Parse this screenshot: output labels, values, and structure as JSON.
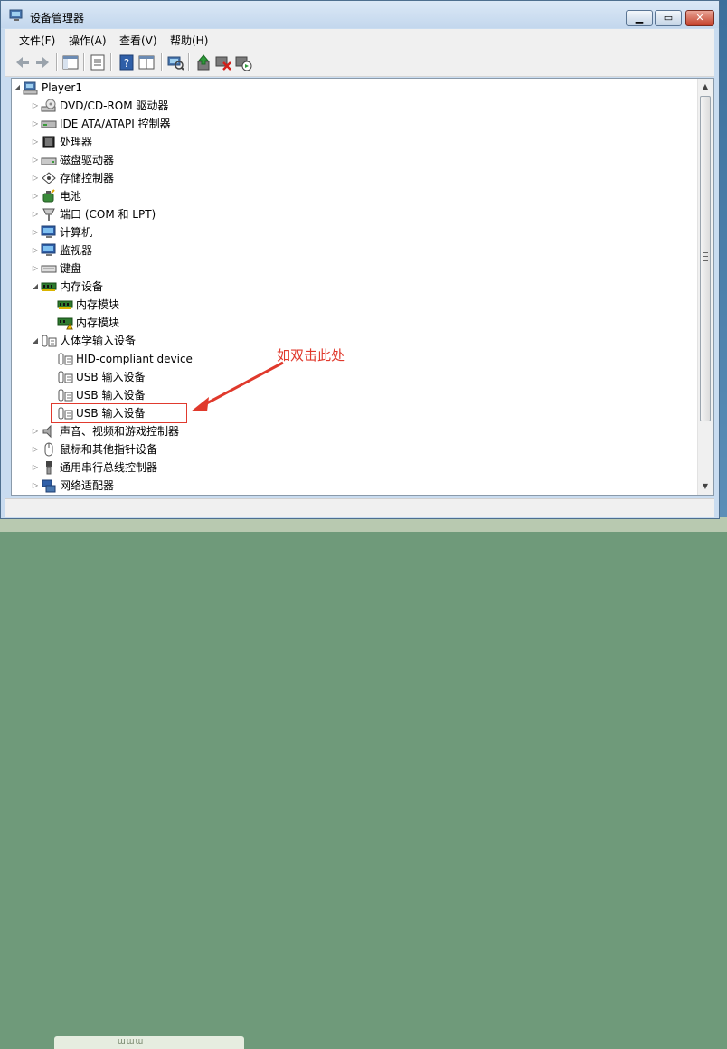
{
  "window": {
    "title": "设备管理器"
  },
  "menu": [
    "文件(F)",
    "操作(A)",
    "查看(V)",
    "帮助(H)"
  ],
  "toolbar": [
    "back-icon",
    "forward-icon",
    "console-tree-icon",
    "properties-icon",
    "help-icon",
    "details-icon",
    "scan-hardware-icon",
    "update-driver-icon",
    "uninstall-icon",
    "enable-device-icon"
  ],
  "tree": [
    {
      "label": "Player1",
      "depth": 0,
      "expander": "open",
      "icon": "computer"
    },
    {
      "label": "DVD/CD-ROM 驱动器",
      "depth": 1,
      "expander": "closed",
      "icon": "dvd"
    },
    {
      "label": "IDE ATA/ATAPI 控制器",
      "depth": 1,
      "expander": "closed",
      "icon": "ide"
    },
    {
      "label": "处理器",
      "depth": 1,
      "expander": "closed",
      "icon": "cpu"
    },
    {
      "label": "磁盘驱动器",
      "depth": 1,
      "expander": "closed",
      "icon": "disk"
    },
    {
      "label": "存储控制器",
      "depth": 1,
      "expander": "closed",
      "icon": "storage"
    },
    {
      "label": "电池",
      "depth": 1,
      "expander": "closed",
      "icon": "battery"
    },
    {
      "label": "端口 (COM 和 LPT)",
      "depth": 1,
      "expander": "closed",
      "icon": "port"
    },
    {
      "label": "计算机",
      "depth": 1,
      "expander": "closed",
      "icon": "monitor"
    },
    {
      "label": "监视器",
      "depth": 1,
      "expander": "closed",
      "icon": "monitor"
    },
    {
      "label": "键盘",
      "depth": 1,
      "expander": "closed",
      "icon": "keyboard"
    },
    {
      "label": "内存设备",
      "depth": 1,
      "expander": "open",
      "icon": "memory"
    },
    {
      "label": "内存模块",
      "depth": 2,
      "expander": "none",
      "icon": "memory"
    },
    {
      "label": "内存模块",
      "depth": 2,
      "expander": "none",
      "icon": "memory-warn"
    },
    {
      "label": "人体学输入设备",
      "depth": 1,
      "expander": "open",
      "icon": "hid"
    },
    {
      "label": "HID-compliant device",
      "depth": 2,
      "expander": "none",
      "icon": "hid"
    },
    {
      "label": "USB 输入设备",
      "depth": 2,
      "expander": "none",
      "icon": "hid"
    },
    {
      "label": "USB 输入设备",
      "depth": 2,
      "expander": "none",
      "icon": "hid"
    },
    {
      "label": "USB 输入设备",
      "depth": 2,
      "expander": "none",
      "icon": "hid"
    },
    {
      "label": "声音、视频和游戏控制器",
      "depth": 1,
      "expander": "closed",
      "icon": "sound"
    },
    {
      "label": "鼠标和其他指针设备",
      "depth": 1,
      "expander": "closed",
      "icon": "mouse"
    },
    {
      "label": "通用串行总线控制器",
      "depth": 1,
      "expander": "closed",
      "icon": "usb"
    },
    {
      "label": "网络适配器",
      "depth": 1,
      "expander": "closed",
      "icon": "network"
    }
  ],
  "annotation": {
    "text": "如双击此处",
    "color": "#e0392c"
  },
  "colors": {
    "annotation": "#e0392c",
    "titlebar": "#c9dcf0"
  }
}
